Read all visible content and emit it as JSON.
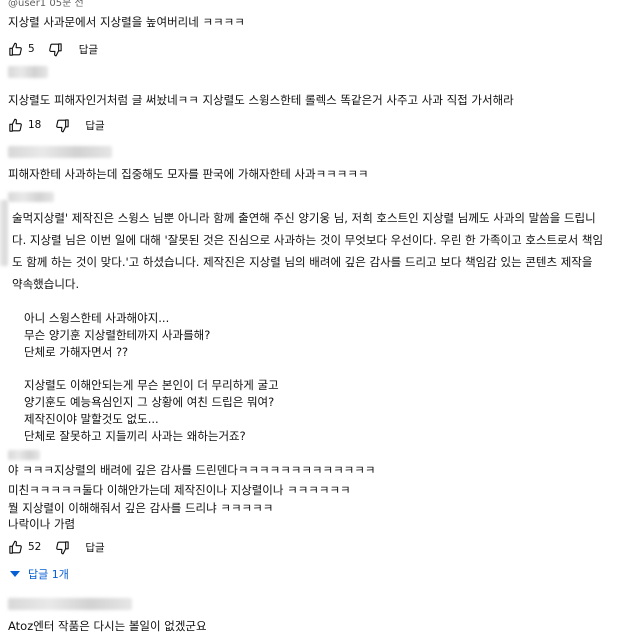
{
  "comments": [
    {
      "meta": "@user1 05분 전",
      "lines": [
        "지상렬 사과문에서 지상렬을 높여버리네 ㅋㅋㅋㅋ"
      ],
      "likes": "5",
      "reply_label": "답글"
    },
    {
      "lines": [
        "지상렬도 피해자인거처럼 글 써놨네ㅋㅋ 지상렬도 스윙스한테 롤렉스 똑같은거 사주고 사과 직접 가서해라"
      ],
      "likes": "18",
      "reply_label": "답글"
    },
    {
      "lines": [
        "피해자한테 사과하는데 집중해도 모자를 판국에 가해자한테 사과ㅋㅋㅋㅋㅋ"
      ]
    },
    {
      "lines": [
        "술먹지상렬' 제작진은 스윙스 님뿐 아니라 함께 출연해 주신 양기웅 님, 저희 호스트인 지상렬 님께도 사과의 말씀을 드립니",
        "다. 지상렬 님은 이번 일에 대해 '잘못된 것은 진심으로 사과하는 것이 무엇보다 우선이다. 우린 한 가족이고 호스트로서 책임",
        "도 함께 하는 것이 맞다.'고 하셨습니다. 제작진은 지상렬 님의 배려에 깊은 감사를 드리고 보다 책임감 있는 콘텐츠 제작을",
        "약속했습니다.",
        "",
        "아니 스윙스한테 사과해야지...",
        "무슨 양기훈 지상렬한테까지 사과를해?",
        "단체로 가해자면서 ??",
        "",
        "지상렬도 이해안되는게 무슨 본인이 더 무리하게 굴고",
        "양기훈도 예능욕심인지 그 상황에 여친 드립은 뭐여?",
        "제작진이야 말할것도 없도...",
        "단체로 잘못하고 지들끼리 사과는 왜하는거죠?"
      ]
    },
    {
      "lines": [
        "야 ㅋㅋㅋ지상렬의 배려에 깊은 감사를 드린덴다ㅋㅋㅋㅋㅋㅋㅋㅋㅋㅋㅋㅋㅋ",
        "미친ㅋㅋㅋㅋㅋ둘다 이해안가는데 제작진이나 지상렬이나 ㅋㅋㅋㅋㅋㅋ",
        "뭘 지상렬이 이해해줘서 깊은 감사를 드리냐 ㅋㅋㅋㅋㅋ",
        "나락이나 가렴"
      ],
      "likes": "52",
      "reply_label": "답글",
      "replies_label": "답글 1개"
    },
    {
      "lines": [
        "Atoz엔터 작품은 다시는 볼일이 없겠군요"
      ]
    }
  ],
  "icons": {
    "like": "thumbs-up-icon",
    "dislike": "thumbs-down-icon",
    "expand": "chevron-down-icon"
  },
  "colors": {
    "text": "#0f0f0f",
    "meta": "#606060",
    "link": "#065fd4"
  }
}
